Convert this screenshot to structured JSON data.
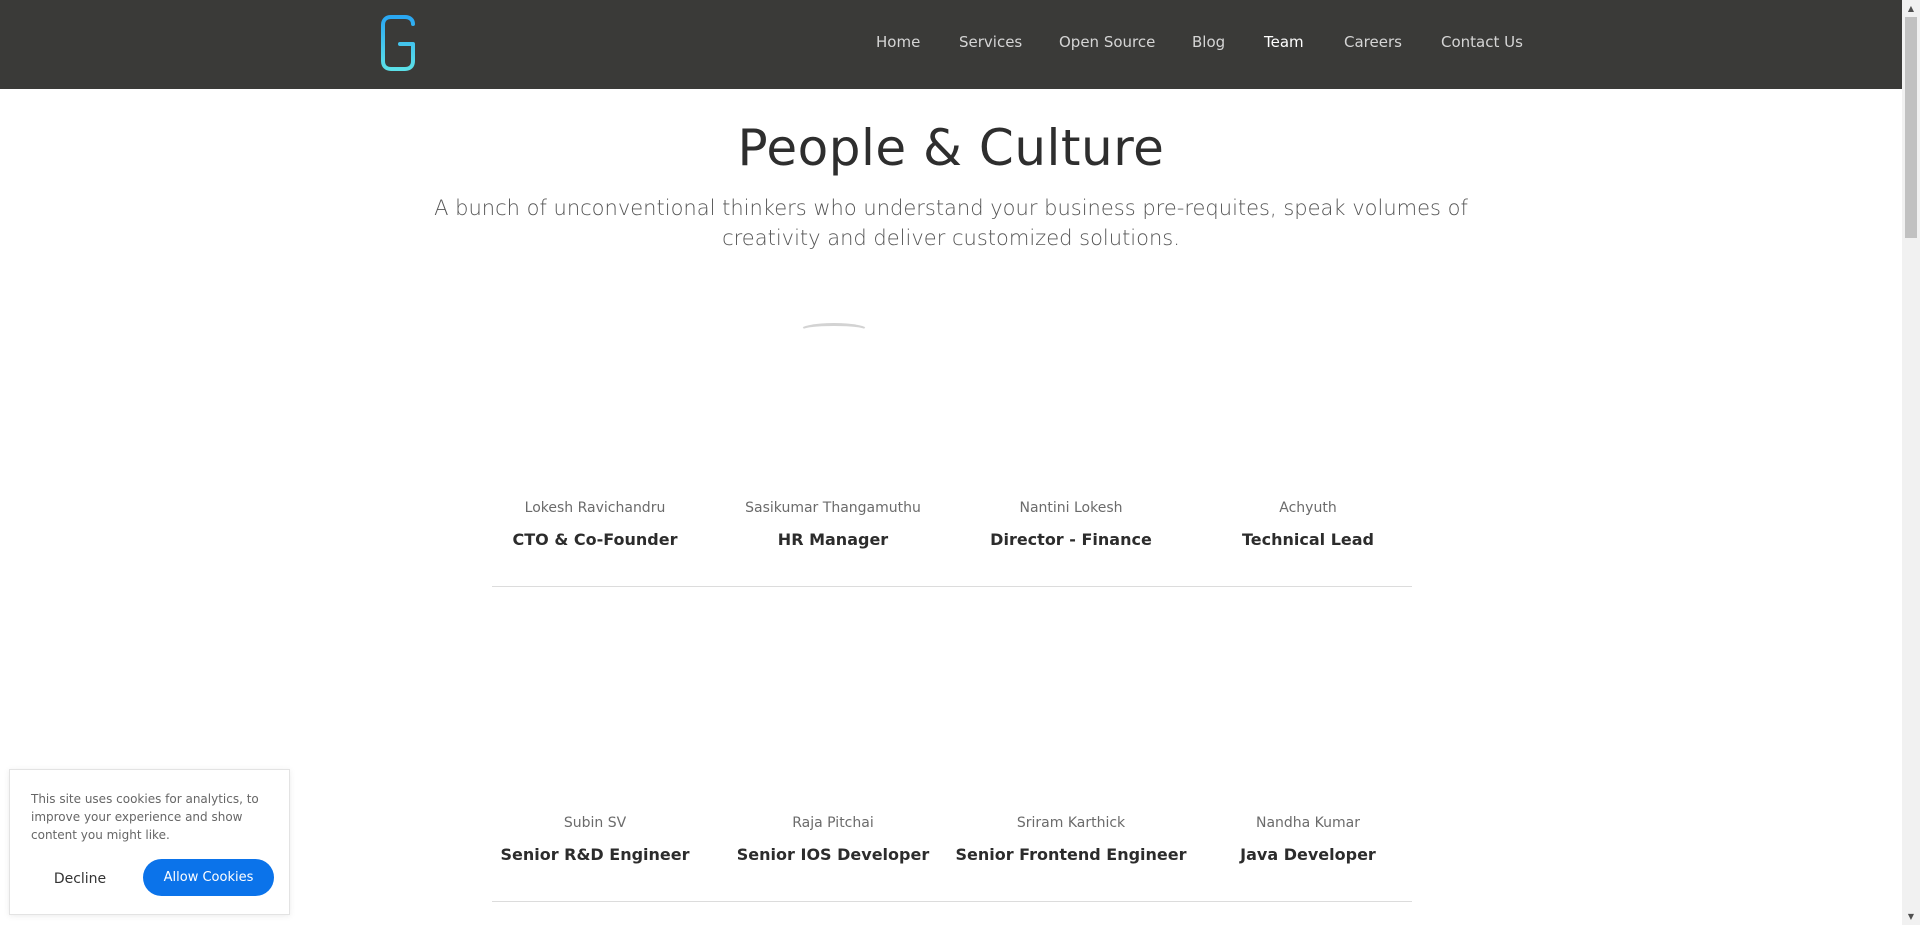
{
  "nav": {
    "items": [
      {
        "label": "Home"
      },
      {
        "label": "Services"
      },
      {
        "label": "Open Source"
      },
      {
        "label": "Blog"
      },
      {
        "label": "Team",
        "active": true
      },
      {
        "label": "Careers"
      },
      {
        "label": "Contact Us"
      }
    ]
  },
  "hero": {
    "title": "People & Culture",
    "subtitle": "A bunch of unconventional thinkers who understand your business pre-requites, speak volumes of creativity and deliver customized solutions."
  },
  "team": {
    "row1": [
      {
        "name": "Lokesh Ravichandru",
        "role": "CTO & Co-Founder"
      },
      {
        "name": "Sasikumar Thangamuthu",
        "role": "HR Manager"
      },
      {
        "name": "Nantini Lokesh",
        "role": "Director - Finance"
      },
      {
        "name": "Achyuth",
        "role": "Technical Lead"
      }
    ],
    "row2": [
      {
        "name": "Subin SV",
        "role": "Senior R&D Engineer"
      },
      {
        "name": "Raja Pitchai",
        "role": "Senior IOS Developer"
      },
      {
        "name": "Sriram Karthick",
        "role": "Senior Frontend Engineer"
      },
      {
        "name": "Nandha Kumar",
        "role": "Java Developer"
      }
    ]
  },
  "cookie": {
    "text": "This site uses cookies for analytics, to improve your experience and show content you might like.",
    "decline_label": "Decline",
    "allow_label": "Allow Cookies"
  },
  "colors": {
    "navbar": "#3a3a38",
    "accent": "#0b73ea",
    "logo_gradient": [
      "#2aa7f2",
      "#5be0e8"
    ]
  }
}
